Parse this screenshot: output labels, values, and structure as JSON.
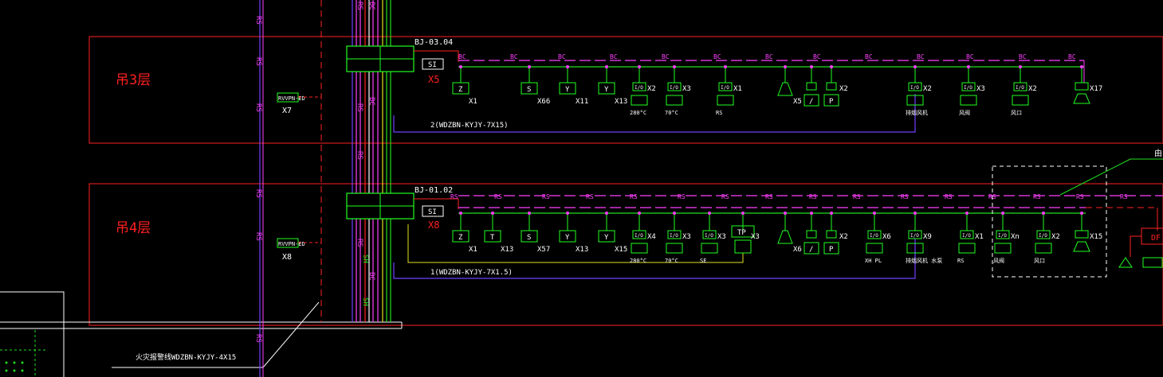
{
  "colors": {
    "background": "#000000",
    "floor_frame": "#ff2020",
    "bus_green": "#20e020",
    "bc_bus": "#ff40ff",
    "rs_bus": "#ff40ff",
    "device": "#20ff20",
    "cable": "#7040ff",
    "cable_yellow": "#e0e020",
    "white": "#ffffff",
    "red_label": "#ff2020"
  },
  "floors": [
    {
      "label": "吊3层",
      "panel_id": "BJ-03.04",
      "si_label": "SI",
      "x_label": "X5",
      "cabinet_label": "X7",
      "cabinet_tag": "RVVPN-ED",
      "bus_label": "BC",
      "cable_label": "2(WDZBN-KYJY-7X15)"
    },
    {
      "label": "吊4层",
      "panel_id": "BJ-01.02",
      "si_label": "SI",
      "x_label": "X8",
      "cabinet_label": "X8",
      "cabinet_tag": "RVVPN-ED",
      "bus_label": "RS",
      "cable_label": "1(WDZBN-KYJY-7X1.5)"
    }
  ],
  "devices_floor3": [
    {
      "sym": "Z",
      "label": "X1"
    },
    {
      "sym": "S",
      "label": "X66"
    },
    {
      "sym": "Y",
      "label": "X11"
    },
    {
      "sym": "Y",
      "label": "X13"
    },
    {
      "sym": "I/O",
      "label": "X2",
      "sub": "280°C"
    },
    {
      "sym": "I/O",
      "label": "X3",
      "sub": "70°C"
    },
    {
      "sym": "I/O",
      "label": "X1",
      "sub": "RS"
    },
    {
      "sym": "HORN",
      "label": "X5"
    },
    {
      "sym": "I",
      "label": "",
      "sub": "/"
    },
    {
      "sym": "I",
      "label": "X2",
      "sub": "P"
    },
    {
      "sym": "I/O",
      "label": "X2",
      "sub": "排烟风机"
    },
    {
      "sym": "I/O",
      "label": "X3",
      "sub": "风阀"
    },
    {
      "sym": "I/O",
      "label": "X2",
      "sub": "风口"
    },
    {
      "sym": "M0",
      "label": "X17"
    }
  ],
  "devices_floor4": [
    {
      "sym": "Z",
      "label": "X1"
    },
    {
      "sym": "T",
      "label": "X13"
    },
    {
      "sym": "S",
      "label": "X57"
    },
    {
      "sym": "Y",
      "label": "X13"
    },
    {
      "sym": "Y",
      "label": "X15"
    },
    {
      "sym": "I/O",
      "label": "X4",
      "sub": "280°C"
    },
    {
      "sym": "I/O",
      "label": "X3",
      "sub": "70°C"
    },
    {
      "sym": "I/O",
      "label": "X3",
      "sub": "SE"
    },
    {
      "sym": "TP",
      "label": "X3"
    },
    {
      "sym": "HORN",
      "label": "X6"
    },
    {
      "sym": "I",
      "label": "",
      "sub": "/"
    },
    {
      "sym": "I",
      "label": "X2",
      "sub": "P"
    },
    {
      "sym": "I/O",
      "label": "X6",
      "sub": "XH PL"
    },
    {
      "sym": "I/O",
      "label": "X9",
      "sub": "排烟风机 水泵"
    },
    {
      "sym": "I/O",
      "label": "X1",
      "sub": "RS"
    },
    {
      "sym": "I/O",
      "label": "Xn",
      "sub": "风阀"
    },
    {
      "sym": "I/O",
      "label": "X2",
      "sub": "风口"
    },
    {
      "sym": "M0",
      "label": "X15"
    }
  ],
  "bottom_cable_label": "火灾报警线WDZBN-KYJY-4X15",
  "right_label": "由",
  "right_box_label": "DF"
}
